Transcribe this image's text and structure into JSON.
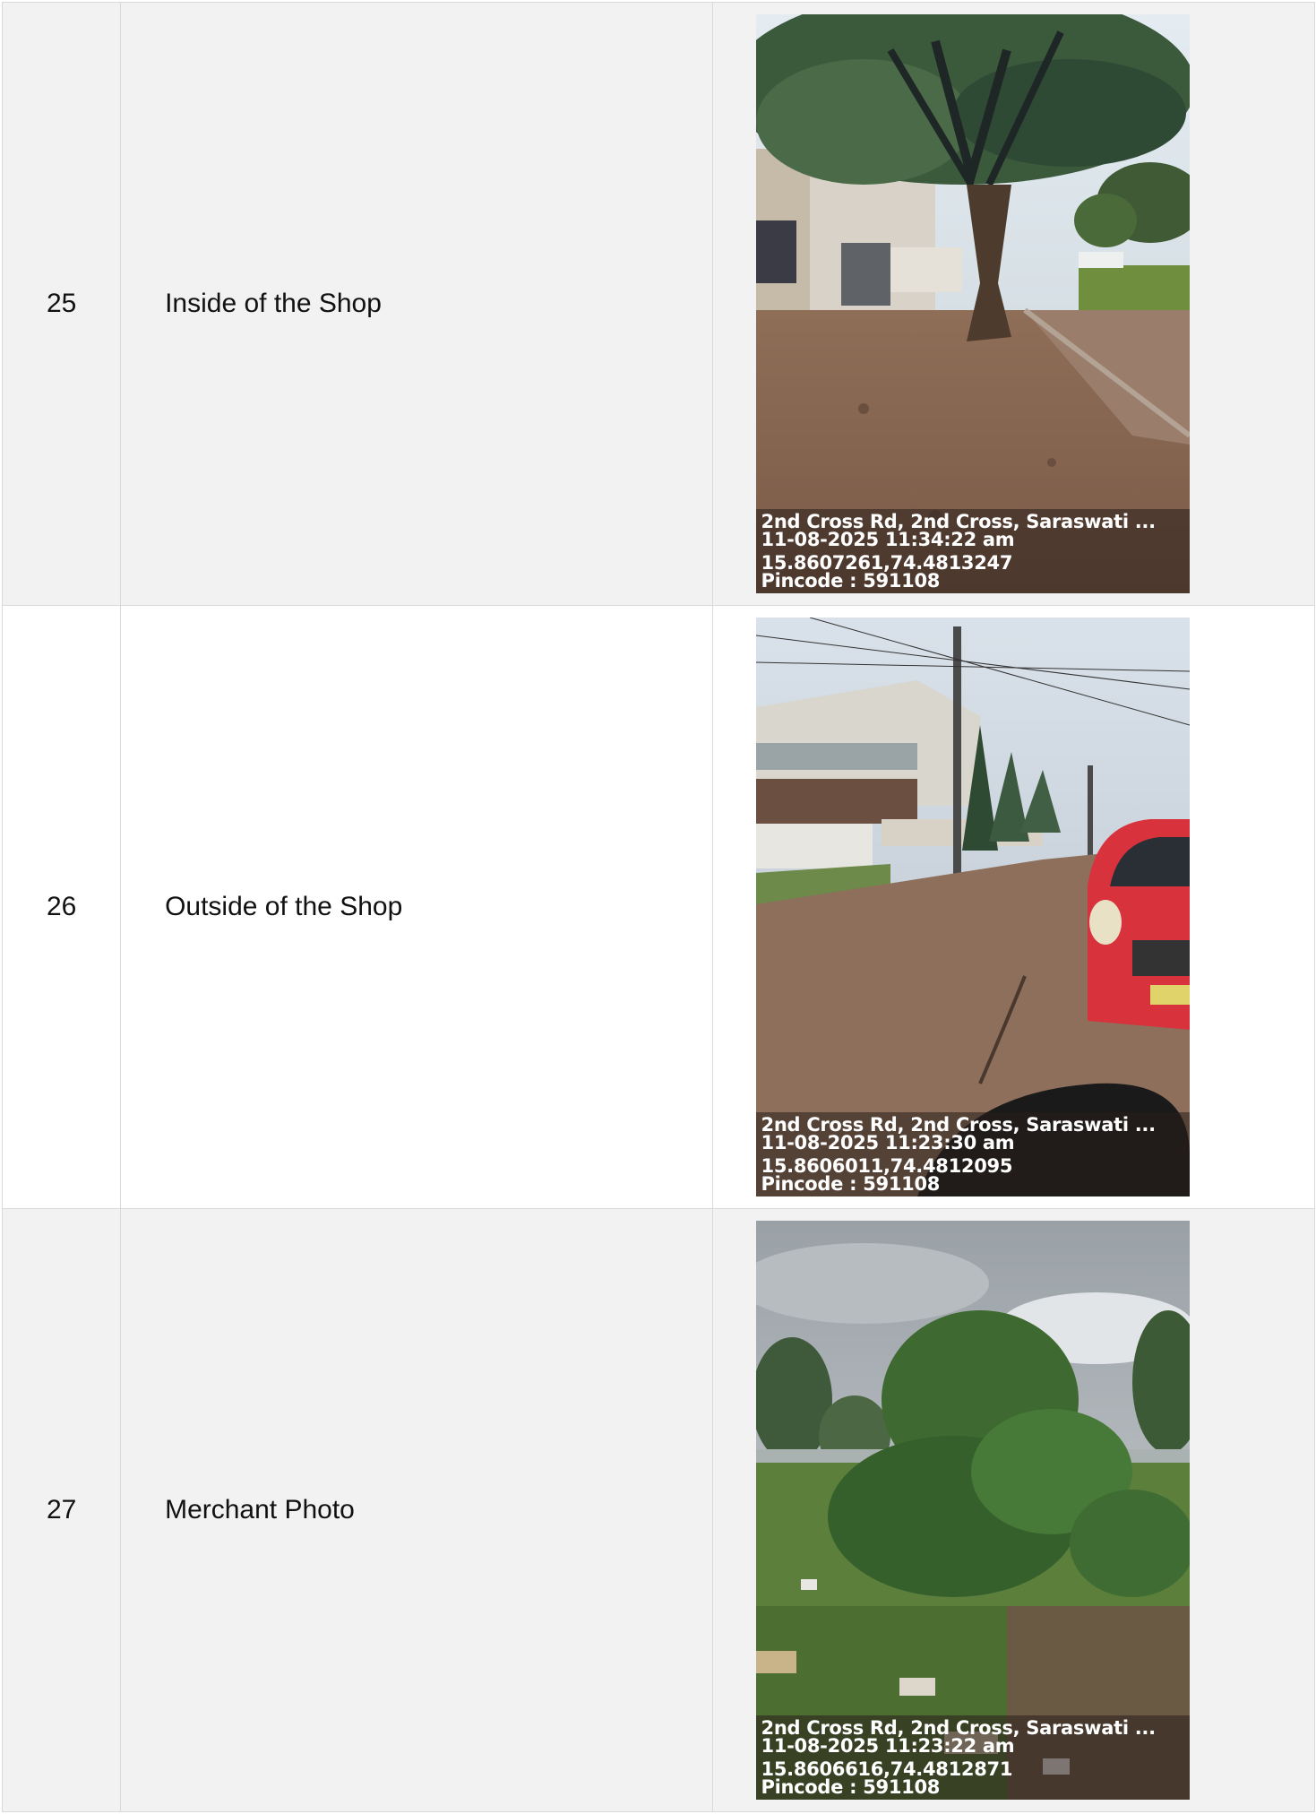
{
  "rows": [
    {
      "number": "25",
      "label": "Inside of the Shop",
      "photo": {
        "scene": "street-with-tree",
        "address": "2nd Cross Rd, 2nd Cross, Saraswati ...",
        "datetime": "11-08-2025 11:34:22 am",
        "coordinates": "15.8607261,74.4813247",
        "pincode": "Pincode : 591108"
      }
    },
    {
      "number": "26",
      "label": "Outside of the Shop",
      "photo": {
        "scene": "road-with-red-car",
        "address": "2nd Cross Rd, 2nd Cross, Saraswati ...",
        "datetime": "11-08-2025 11:23:30 am",
        "coordinates": "15.8606011,74.4812095",
        "pincode": "Pincode : 591108"
      }
    },
    {
      "number": "27",
      "label": "Merchant Photo",
      "photo": {
        "scene": "vacant-plot-with-shrubs",
        "address": "2nd Cross Rd, 2nd Cross, Saraswati ...",
        "datetime": "11-08-2025 11:23:22 am",
        "coordinates": "15.8606616,74.4812871",
        "pincode": "Pincode : 591108"
      }
    }
  ]
}
